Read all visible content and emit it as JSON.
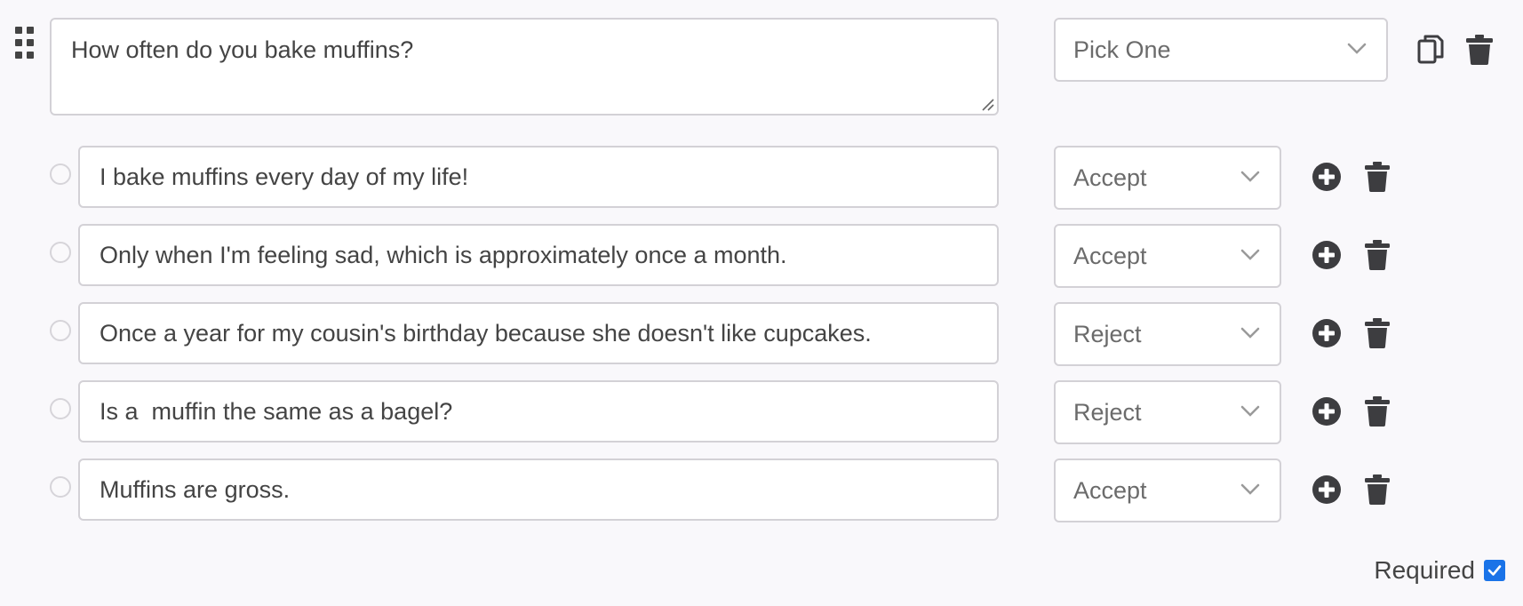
{
  "question": {
    "text": "How often do you bake muffins?",
    "type_select": "Pick One"
  },
  "answers": [
    {
      "text": "I bake muffins every day of my life!",
      "action": "Accept"
    },
    {
      "text": "Only when I'm feeling sad, which is approximately once a month.",
      "action": "Accept"
    },
    {
      "text": "Once a year for my cousin's birthday because she doesn't like cupcakes.",
      "action": "Reject"
    },
    {
      "text": "Is a  muffin the same as a bagel?",
      "action": "Reject"
    },
    {
      "text": "Muffins are gross.",
      "action": "Accept"
    }
  ],
  "required": {
    "label": "Required",
    "checked": true
  },
  "colors": {
    "accent": "#1a73e8",
    "icon": "#3d3d40",
    "border": "#d3d1d6",
    "background": "#f9f8fb"
  },
  "icons": [
    "drag-handle-icon",
    "copy-icon",
    "trash-icon",
    "plus-circle-icon",
    "chevron-down-icon",
    "checkmark-icon"
  ]
}
